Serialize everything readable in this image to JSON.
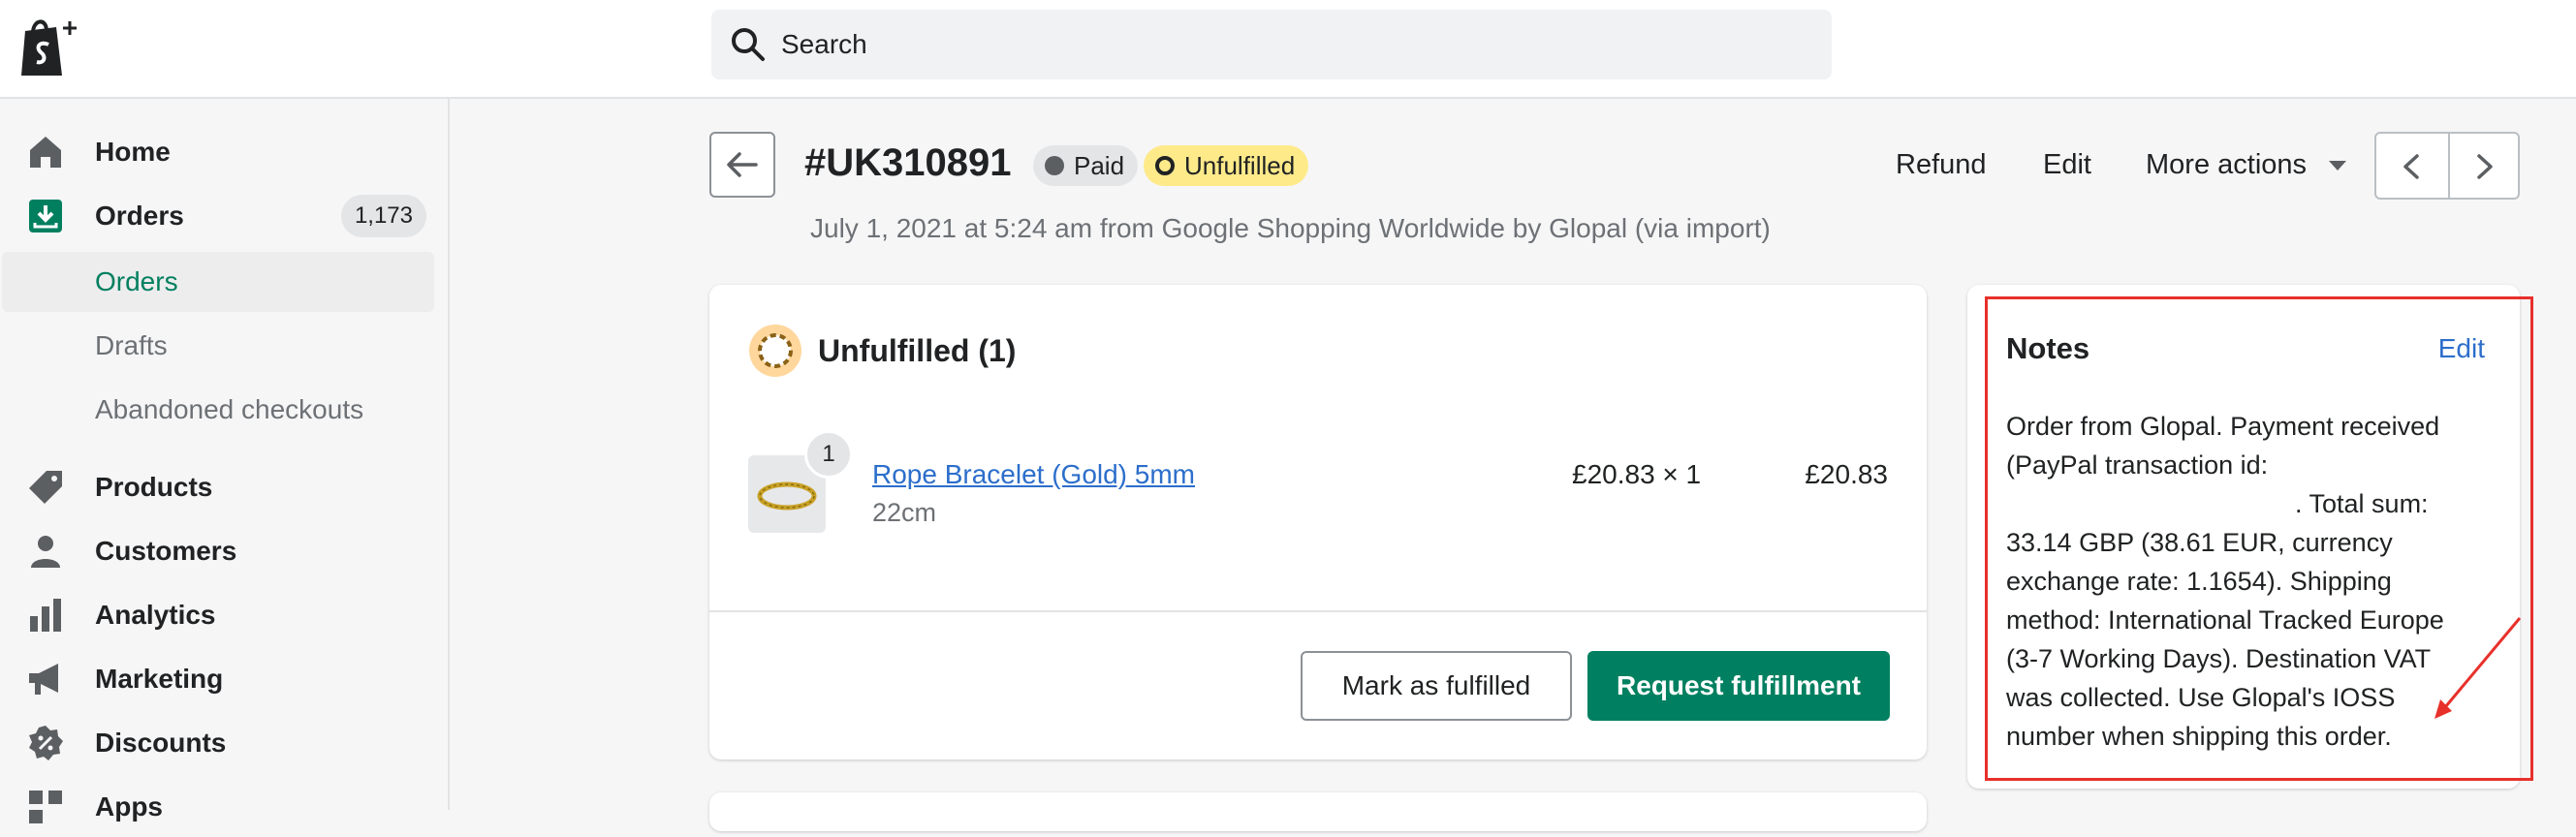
{
  "topbar": {
    "logo_icon": "shopify-bag-icon",
    "search_placeholder": "Search"
  },
  "sidebar": {
    "items": [
      {
        "label": "Home",
        "icon": "home-icon"
      },
      {
        "label": "Orders",
        "icon": "orders-icon",
        "badge": "1,173"
      },
      {
        "label": "Orders",
        "sub": true,
        "active": true
      },
      {
        "label": "Drafts",
        "sub": true
      },
      {
        "label": "Abandoned checkouts",
        "sub": true
      },
      {
        "label": "Products",
        "icon": "tag-icon"
      },
      {
        "label": "Customers",
        "icon": "person-icon"
      },
      {
        "label": "Analytics",
        "icon": "bar-chart-icon"
      },
      {
        "label": "Marketing",
        "icon": "megaphone-icon"
      },
      {
        "label": "Discounts",
        "icon": "discount-icon"
      },
      {
        "label": "Apps",
        "icon": "apps-icon"
      }
    ]
  },
  "header": {
    "order_number": "#UK310891",
    "payment_status": "Paid",
    "fulfillment_status": "Unfulfilled",
    "subtitle": "July 1, 2021 at 5:24 am from Google Shopping Worldwide by Glopal (via import)",
    "actions": {
      "refund": "Refund",
      "edit": "Edit",
      "more": "More actions"
    }
  },
  "fulfillment_card": {
    "title": "Unfulfilled (1)",
    "item": {
      "quantity_badge": "1",
      "name": "Rope Bracelet (Gold) 5mm",
      "variant": "22cm",
      "unit_price": "£20.83 × 1",
      "total": "£20.83"
    },
    "buttons": {
      "mark_fulfilled": "Mark as fulfilled",
      "request_fulfillment": "Request fulfillment"
    }
  },
  "notes": {
    "title": "Notes",
    "edit": "Edit",
    "lines": [
      "Order from Glopal. Payment received",
      "(PayPal transaction id:",
      ". Total sum:",
      "33.14 GBP (38.61 EUR, currency",
      "exchange rate: 1.1654). Shipping",
      "method: International Tracked Europe",
      "(3-7 Working Days). Destination VAT",
      "was collected. Use Glopal's IOSS",
      "number when shipping this order."
    ]
  },
  "colors": {
    "accent_green": "#008060",
    "link_blue": "#2c6ecb",
    "unfulfilled_yellow": "#ffea8a",
    "annotation_red": "#e8302b"
  }
}
